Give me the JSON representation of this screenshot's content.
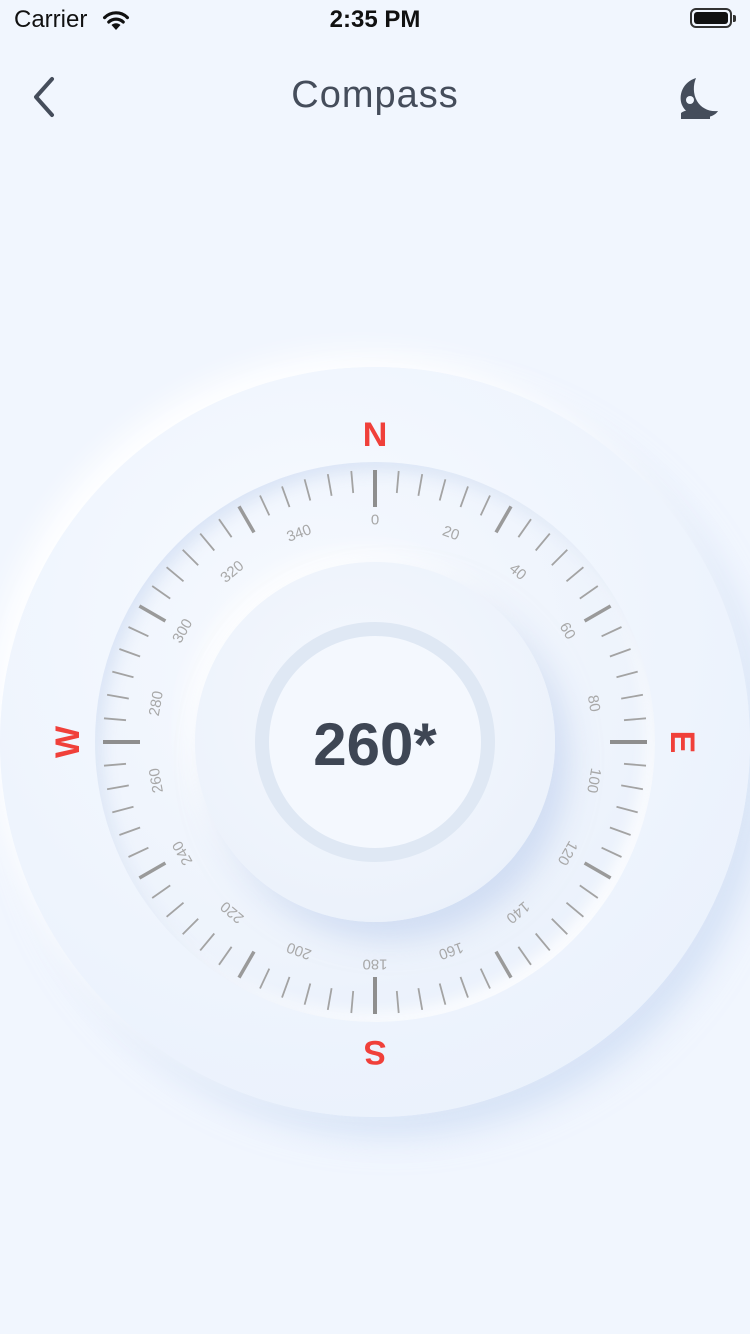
{
  "status_bar": {
    "carrier": "Carrier",
    "time": "2:35 PM"
  },
  "nav": {
    "title": "Compass",
    "back_icon": "chevron-left-icon",
    "theme_icon": "moon-icon"
  },
  "compass": {
    "heading_display": "260*",
    "heading_degrees": 260,
    "cardinals": {
      "north": "N",
      "east": "E",
      "south": "S",
      "west": "W"
    },
    "degree_labels": [
      "0",
      "20",
      "40",
      "60",
      "80",
      "100",
      "120",
      "140",
      "160",
      "180",
      "200",
      "220",
      "240",
      "260",
      "280",
      "300",
      "320",
      "340"
    ]
  },
  "colors": {
    "background": "#f1f6fe",
    "cardinal": "#f0403a",
    "tick": "#a3a3a3",
    "degree_label": "#a8a8a8",
    "title": "#454d5b",
    "heading": "#3e4654"
  }
}
